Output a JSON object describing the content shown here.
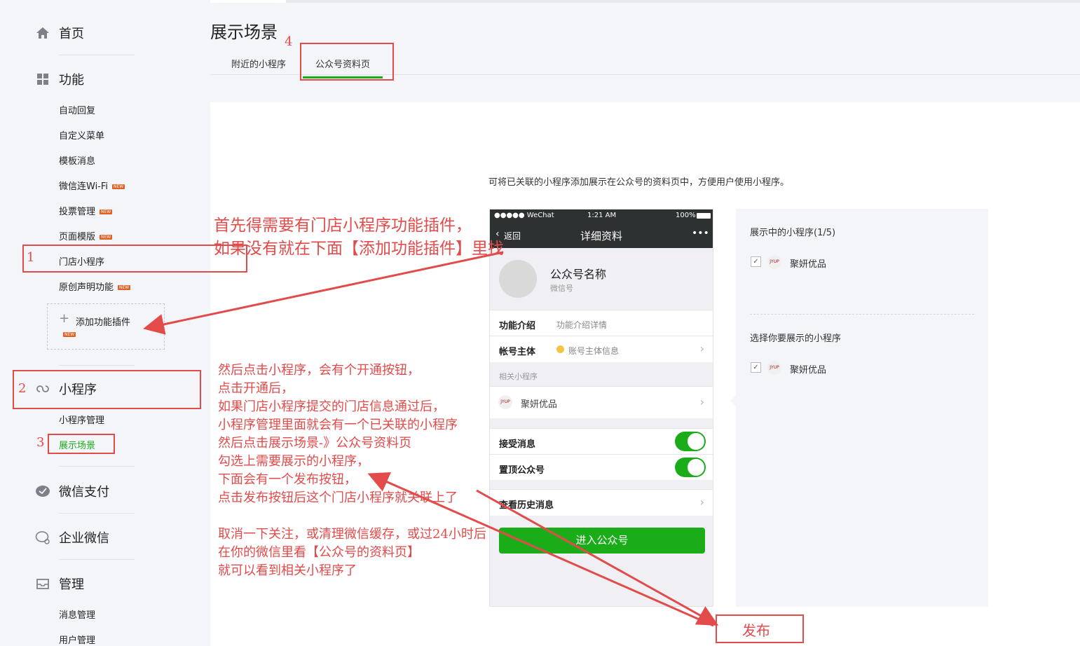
{
  "sidebar": {
    "sections": [
      {
        "label": "首页",
        "icon": "home-icon"
      },
      {
        "label": "功能",
        "icon": "grid-icon"
      },
      {
        "label": "小程序",
        "icon": "mini-program-icon"
      },
      {
        "label": "微信支付",
        "icon": "wechat-pay-icon"
      },
      {
        "label": "企业微信",
        "icon": "work-wechat-icon"
      },
      {
        "label": "管理",
        "icon": "inbox-icon"
      }
    ],
    "function_items": [
      {
        "label": "自动回复",
        "badge": ""
      },
      {
        "label": "自定义菜单",
        "badge": ""
      },
      {
        "label": "模板消息",
        "badge": ""
      },
      {
        "label": "微信连Wi-Fi",
        "badge": "NEW"
      },
      {
        "label": "投票管理",
        "badge": "NEW"
      },
      {
        "label": "页面模版",
        "badge": "NEW"
      },
      {
        "label": "门店小程序",
        "badge": ""
      },
      {
        "label": "原创声明功能",
        "badge": "NEW"
      }
    ],
    "add_plugin": {
      "label": "添加功能插件",
      "badge": "NEW"
    },
    "miniprogram_items": [
      {
        "label": "小程序管理"
      },
      {
        "label": "展示场景"
      }
    ],
    "manage_items": [
      {
        "label": "消息管理"
      },
      {
        "label": "用户管理"
      }
    ]
  },
  "main": {
    "title": "展示场景",
    "tabs": [
      {
        "label": "附近的小程序"
      },
      {
        "label": "公众号资料页"
      }
    ],
    "description": "可将已关联的小程序添加展示在公众号的资料页中，方便用户使用小程序。"
  },
  "phone": {
    "status_carrier": "●●●●● WeChat",
    "status_time": "1:21 AM",
    "status_battery": "100%",
    "nav_back": "返回",
    "nav_title": "详细资料",
    "nav_more": "•••",
    "account_name": "公众号名称",
    "account_id": "微信号",
    "rows": {
      "intro_label": "功能介绍",
      "intro_value": "功能介绍详情",
      "subject_label": "帐号主体",
      "subject_value": "账号主体信息",
      "related_header": "相关小程序",
      "related_item": "聚妍优品",
      "receive_label": "接受消息",
      "pin_label": "置顶公众号",
      "history_label": "查看历史消息"
    },
    "enter_button": "进入公众号"
  },
  "right_panel": {
    "showing_title": "展示中的小程序(1/5)",
    "showing_item": "聚妍优品",
    "select_title": "选择你要展示的小程序",
    "select_item": "聚妍优品",
    "logo_text": "JYUP"
  },
  "annotations": {
    "note_top_1": "首先得需要有门店小程序功能插件，",
    "note_top_2": "如果没有就在下面【添加功能插件】里找",
    "steps": [
      "然后点击小程序，会有个开通按钮，",
      "点击开通后，",
      "如果门店小程序提交的门店信息通过后，",
      "小程序管理里面就会有一个已关联的小程序",
      "然后点击展示场景-》公众号资料页",
      "勾选上需要展示的小程序，",
      "下面会有一个发布按钮，",
      "点击发布按钮后这个门店小程序就关联上了",
      "",
      "取消一下关注，或清理微信缓存，或过24小时后",
      "在你的微信里看【公众号的资料页】",
      "就可以看到相关小程序了"
    ],
    "num1": "1",
    "num2": "2",
    "num3": "3",
    "num4": "4",
    "publish_label": "发布"
  },
  "colors": {
    "accent_green": "#1aad19",
    "annotation_red": "#e34a4a",
    "badge_orange": "#e15f21"
  }
}
